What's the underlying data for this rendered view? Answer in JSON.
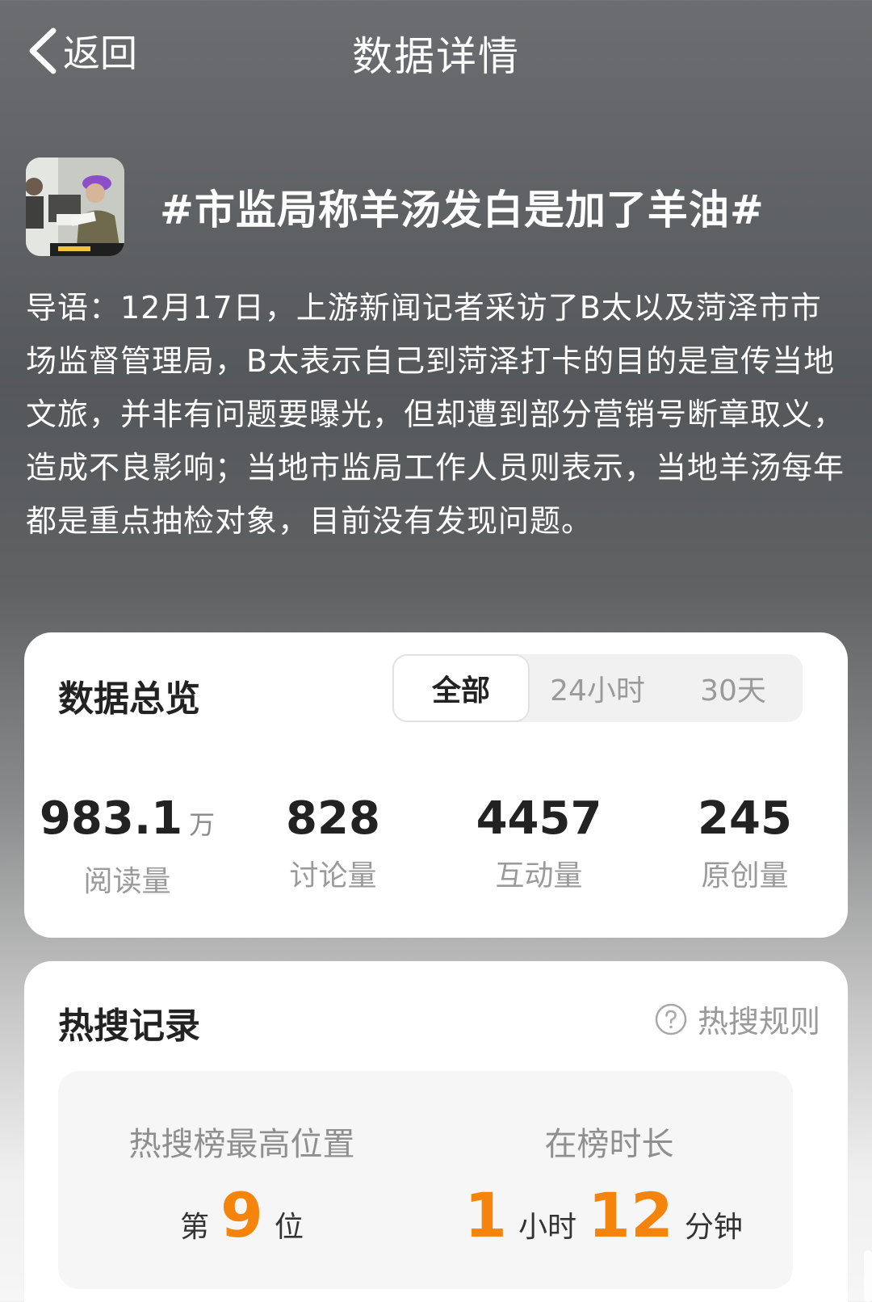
{
  "nav": {
    "back_label": "返回",
    "title": "数据详情"
  },
  "topic": {
    "title": "#市监局称羊汤发白是加了羊油#",
    "intro": "导语：12月17日，上游新闻记者采访了B太以及菏泽市市场监督管理局，B太表示自己到菏泽打卡的目的是宣传当地文旅，并非有问题要曝光，但却遭到部分营销号断章取义，造成不良影响；当地市监局工作人员则表示，当地羊汤每年都是重点抽检对象，目前没有发现问题。"
  },
  "overview": {
    "title": "数据总览",
    "tabs": [
      {
        "label": "全部",
        "active": true
      },
      {
        "label": "24小时",
        "active": false
      },
      {
        "label": "30天",
        "active": false
      }
    ],
    "stats": [
      {
        "value": "983.1",
        "unit": "万",
        "label": "阅读量"
      },
      {
        "value": "828",
        "unit": "",
        "label": "讨论量"
      },
      {
        "value": "4457",
        "unit": "",
        "label": "互动量"
      },
      {
        "value": "245",
        "unit": "",
        "label": "原创量"
      }
    ]
  },
  "records": {
    "title": "热搜记录",
    "rules_label": "热搜规则",
    "highest_label": "热搜榜最高位置",
    "highest_prefix": "第",
    "highest_value": "9",
    "highest_suffix": "位",
    "duration_label": "在榜时长",
    "duration_hours": "1",
    "duration_hours_unit": "小时",
    "duration_minutes": "12",
    "duration_minutes_unit": "分钟",
    "accent_color": "#f5840c"
  },
  "icons": {
    "back": "chevron-left-icon",
    "rules": "question-circle-icon"
  }
}
